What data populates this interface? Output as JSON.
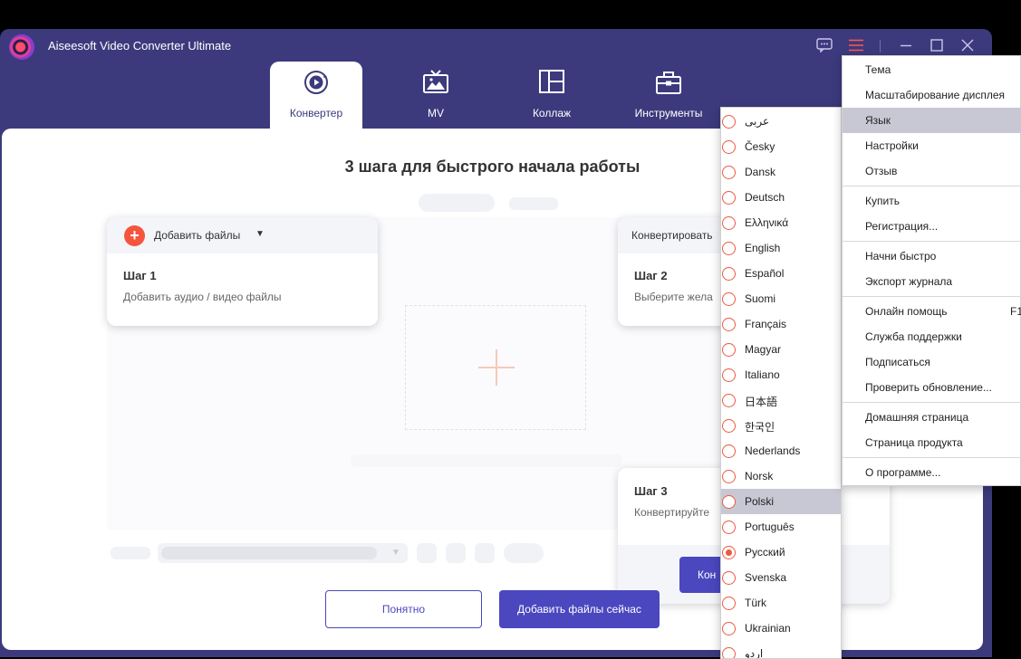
{
  "window": {
    "title": "Aiseesoft Video Converter Ultimate"
  },
  "tabs": [
    {
      "label": "Конвертер",
      "icon": "converter-icon",
      "active": true
    },
    {
      "label": "MV",
      "icon": "tv-icon",
      "active": false
    },
    {
      "label": "Коллаж",
      "icon": "collage-icon",
      "active": false
    },
    {
      "label": "Инструменты",
      "icon": "toolbox-icon",
      "active": false
    }
  ],
  "guide": {
    "title": "3 шага для быстрого начала работы",
    "step1": {
      "head": "Добавить файлы",
      "step": "Шаг 1",
      "desc": "Добавить аудио / видео файлы"
    },
    "step2": {
      "head": "Конвертировать",
      "step": "Шаг 2",
      "desc": "Выберите жела"
    },
    "step3": {
      "step": "Шаг 3",
      "desc": "Конвертируйте",
      "button": "Кон"
    },
    "ok_button": "Понятно",
    "add_now_button": "Добавить файлы сейчас"
  },
  "language_menu": [
    {
      "label": "عربى",
      "selected": false
    },
    {
      "label": "Česky",
      "selected": false
    },
    {
      "label": "Dansk",
      "selected": false
    },
    {
      "label": "Deutsch",
      "selected": false
    },
    {
      "label": "Ελληνικά",
      "selected": false
    },
    {
      "label": "English",
      "selected": false
    },
    {
      "label": "Español",
      "selected": false
    },
    {
      "label": "Suomi",
      "selected": false
    },
    {
      "label": "Français",
      "selected": false
    },
    {
      "label": "Magyar",
      "selected": false
    },
    {
      "label": "Italiano",
      "selected": false
    },
    {
      "label": "日本語",
      "selected": false
    },
    {
      "label": "한국인",
      "selected": false
    },
    {
      "label": "Nederlands",
      "selected": false
    },
    {
      "label": "Norsk",
      "selected": false
    },
    {
      "label": "Polski",
      "selected": false,
      "hovered": true
    },
    {
      "label": "Português",
      "selected": false
    },
    {
      "label": "Русский",
      "selected": true
    },
    {
      "label": "Svenska",
      "selected": false
    },
    {
      "label": "Türk",
      "selected": false
    },
    {
      "label": "Ukrainian",
      "selected": false
    },
    {
      "label": "اردو",
      "selected": false
    }
  ],
  "main_menu": {
    "groups": [
      [
        {
          "label": "Тема"
        },
        {
          "label": "Масштабирование дисплея"
        },
        {
          "label": "Язык",
          "hovered": true
        },
        {
          "label": "Настройки"
        },
        {
          "label": "Отзыв"
        }
      ],
      [
        {
          "label": "Купить"
        },
        {
          "label": "Регистрация..."
        }
      ],
      [
        {
          "label": "Начни быстро"
        },
        {
          "label": "Экспорт журнала"
        }
      ],
      [
        {
          "label": "Онлайн помощь",
          "shortcut": "F1"
        },
        {
          "label": "Служба поддержки"
        },
        {
          "label": "Подписаться"
        },
        {
          "label": "Проверить обновление..."
        }
      ],
      [
        {
          "label": "Домашняя страница"
        },
        {
          "label": "Страница продукта"
        }
      ],
      [
        {
          "label": "О программе..."
        }
      ]
    ]
  },
  "colors": {
    "header_bg": "#3c3a7d",
    "accent": "#4b47bf",
    "orange": "#f4553c",
    "menu_highlight": "#c8c8d5"
  }
}
